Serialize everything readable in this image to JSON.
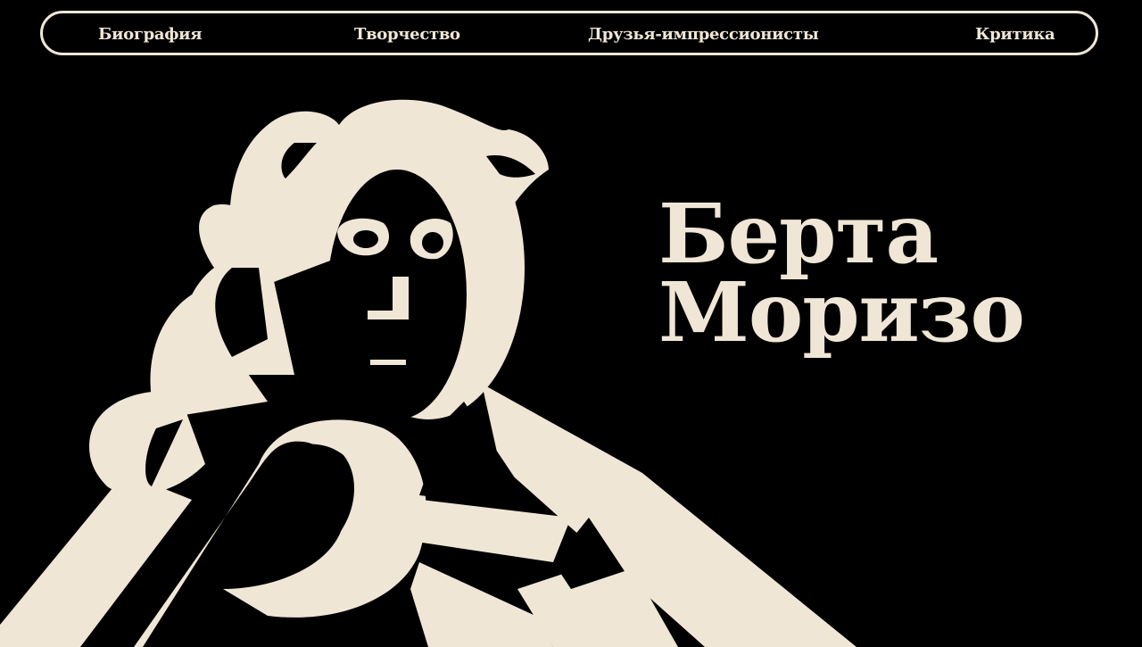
{
  "nav": {
    "items": [
      {
        "label": "Биография"
      },
      {
        "label": "Творчество"
      },
      {
        "label": "Друзья-импрессионисты"
      },
      {
        "label": "Критика"
      }
    ]
  },
  "hero": {
    "title_line1": "Берта",
    "title_line2": "Моризо"
  },
  "colors": {
    "background": "#000000",
    "accent": "#f0e6d6"
  },
  "illustration": {
    "icon": "woman-portrait-illustration"
  }
}
